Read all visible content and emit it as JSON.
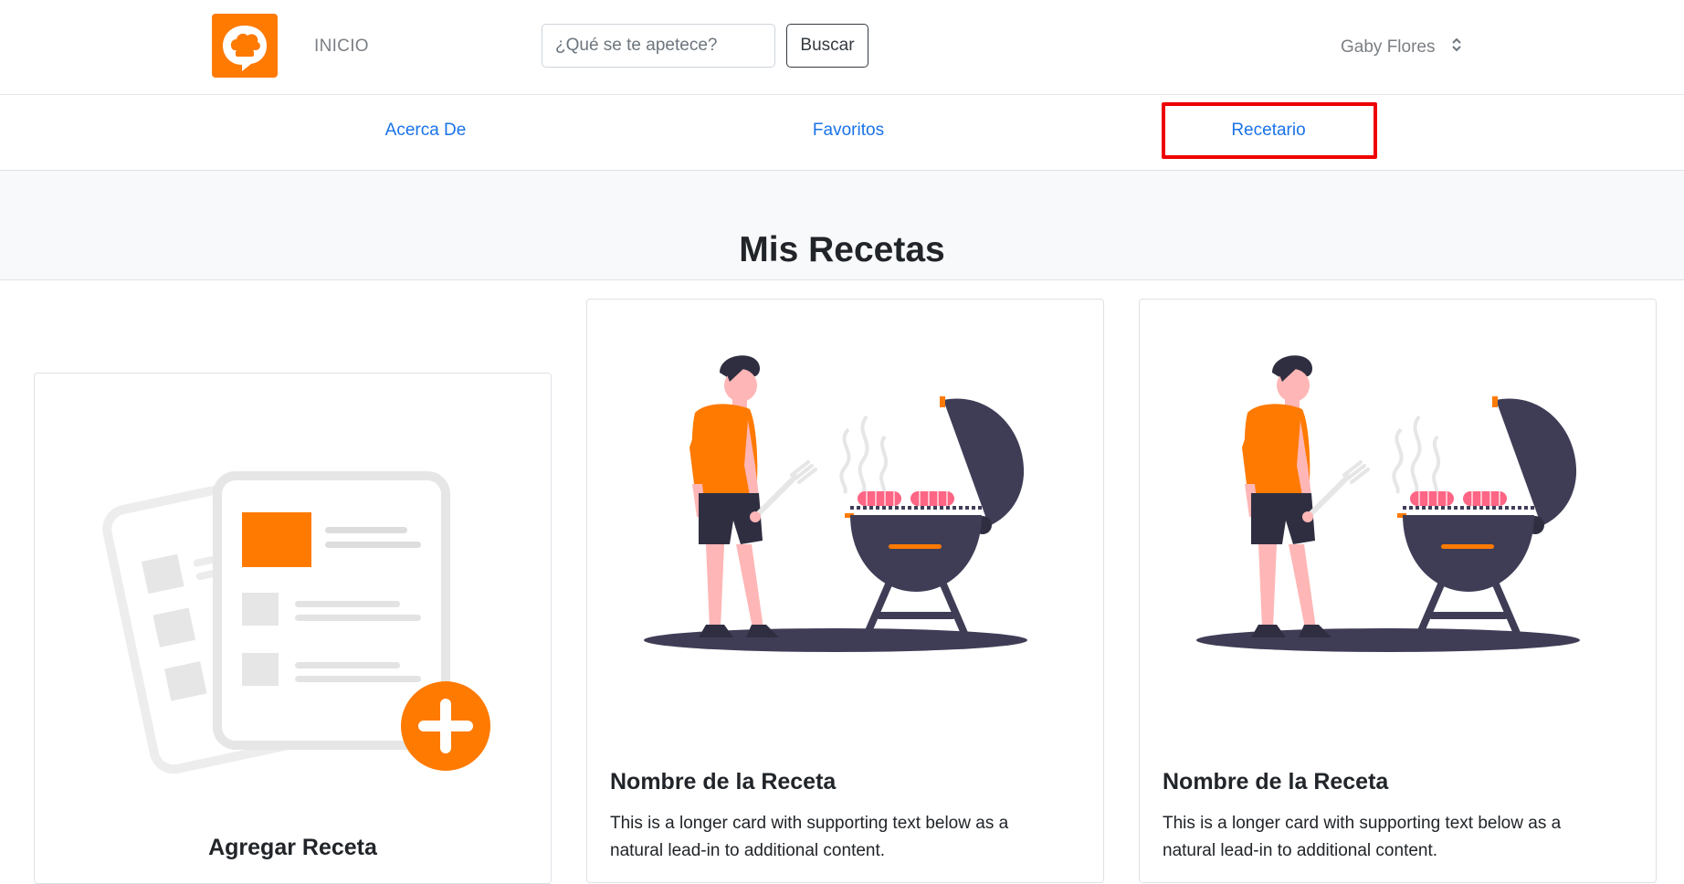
{
  "header": {
    "logo_icon": "chef-hat-chat-icon",
    "home_label": "INICIO",
    "search": {
      "placeholder": "¿Qué se te apetece?",
      "value": "",
      "button_label": "Buscar"
    },
    "user": {
      "name": "Gaby Flores",
      "menu_icon": "chevron-up-down-icon"
    }
  },
  "nav": {
    "items": [
      {
        "label": "Acerca De"
      },
      {
        "label": "Favoritos"
      },
      {
        "label": "Recetario",
        "highlighted": true
      }
    ]
  },
  "section": {
    "title": "Mis Recetas"
  },
  "cards": {
    "add": {
      "title": "Agregar Receta",
      "icon": "add-recipe-icon"
    },
    "recipes": [
      {
        "title": "Nombre de la Receta",
        "text": "This is a longer card with supporting text below as a natural lead-in to additional content.",
        "image": "man-grilling-illustration"
      },
      {
        "title": "Nombre de la Receta",
        "text": "This is a longer card with supporting text below as a natural lead-in to additional content.",
        "image": "man-grilling-illustration"
      }
    ]
  },
  "colors": {
    "brand": "#ff7a00",
    "link": "#1a73e8",
    "highlight": "#ee0000",
    "grill": "#3f3d56",
    "skin": "#ffb6b6"
  }
}
